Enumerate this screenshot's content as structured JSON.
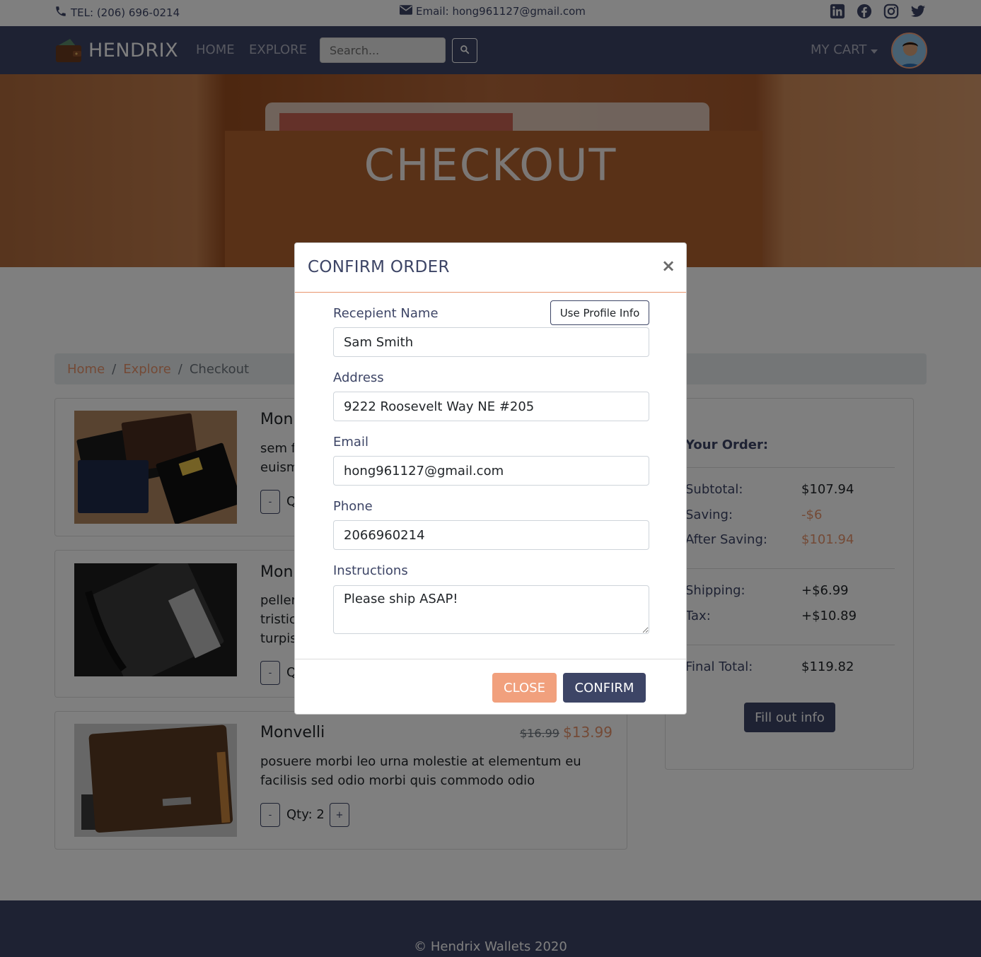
{
  "topbar": {
    "tel": "TEL: (206) 696-0214",
    "email": "Email: hong961127@gmail.com",
    "socials": [
      "linkedin-icon",
      "facebook-icon",
      "instagram-icon",
      "twitter-icon"
    ]
  },
  "navbar": {
    "brand": "HENDRIX",
    "home": "HOME",
    "explore": "EXPLORE",
    "search_placeholder": "Search...",
    "cart": "MY CART"
  },
  "hero": {
    "title": "CHECKOUT"
  },
  "breadcrumb": {
    "home": "Home",
    "explore": "Explore",
    "current": "Checkout"
  },
  "products": [
    {
      "name": "Mon",
      "desc_lines": [
        "sem f",
        "euism"
      ],
      "qty_label": "Q"
    },
    {
      "name": "Mon",
      "desc_lines": [
        "peller",
        "tristic",
        "turpis"
      ],
      "qty_label": "Q"
    },
    {
      "name": "Monvelli",
      "desc_lines": [
        "posuere morbi leo urna molestie at elementum eu",
        "facilisis sed odio morbi quis commodo odio"
      ],
      "qty_label": "Qty: 2",
      "old_price": "$16.99",
      "new_price": "$13.99"
    }
  ],
  "qty_buttons": {
    "minus": "-",
    "plus": "+"
  },
  "summary": {
    "heading": "Your Order:",
    "subtotal_label": "Subtotal:",
    "subtotal": "$107.94",
    "saving_label": "Saving:",
    "saving": "-$6",
    "after_label": "After Saving:",
    "after": "$101.94",
    "shipping_label": "Shipping:",
    "shipping": "+$6.99",
    "tax_label": "Tax:",
    "tax": "+$10.89",
    "final_label": "Final Total:",
    "final": "$119.82",
    "button": "Fill out info"
  },
  "footer": {
    "copyright": "© Hendrix Wallets 2020"
  },
  "modal": {
    "title": "CONFIRM ORDER",
    "close_symbol": "×",
    "profile_button": "Use Profile Info",
    "name_label": "Recepient Name",
    "name_value": "Sam Smith",
    "address_label": "Address",
    "address_value": "9222 Roosevelt Way NE #205",
    "email_label": "Email",
    "email_value": "hong961127@gmail.com",
    "phone_label": "Phone",
    "phone_value": "2066960214",
    "instructions_label": "Instructions",
    "instructions_value": "Please ship ASAP!",
    "close_button": "CLOSE",
    "confirm_button": "CONFIRM"
  },
  "colors": {
    "navy": "#3d4566",
    "accent": "#e8956d",
    "close_button": "#f1a07d"
  }
}
